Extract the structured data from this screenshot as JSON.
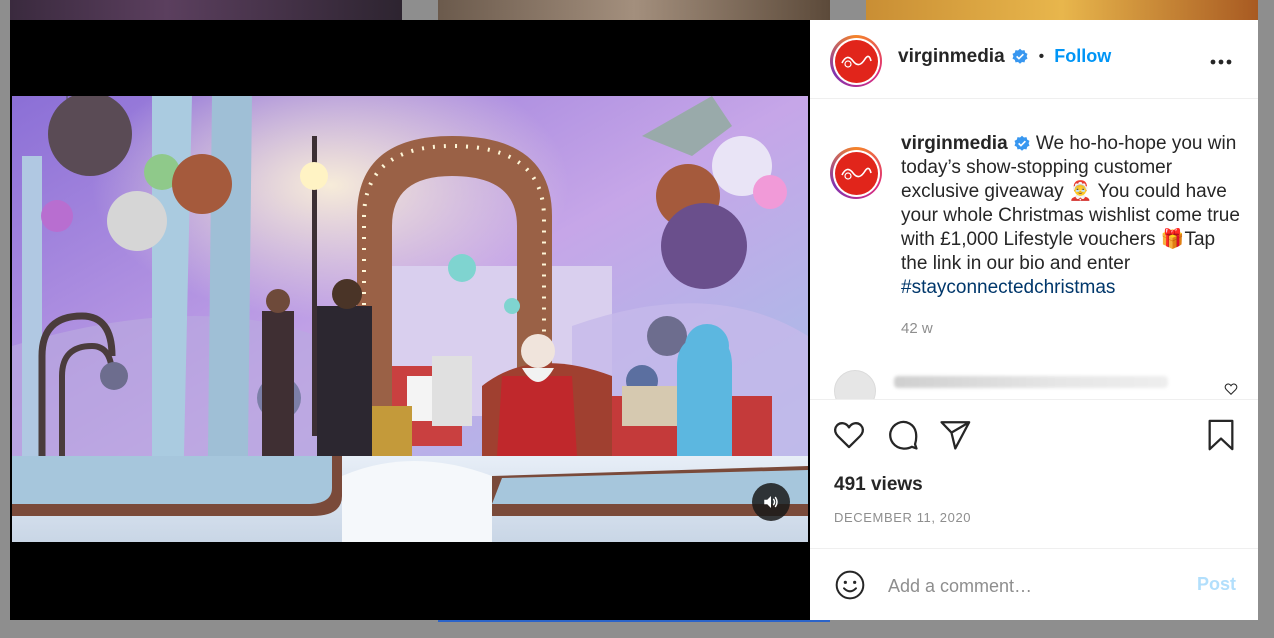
{
  "post": {
    "username": "virginmedia",
    "verified": true,
    "separator": "•",
    "follow_label": "Follow",
    "more_icon": "more-horizontal-icon",
    "caption": {
      "part1": " We ho-ho-hope you win today’s show-stopping customer exclusive giveaway ",
      "emoji1": "🤶",
      "part2": " You could have your whole Christmas wishlist come true with £1,000 Lifestyle vouchers ",
      "emoji2": "🎁",
      "part3": "Tap the link in our bio and enter ",
      "hashtag": "#stayconnectedchristmas"
    },
    "time_ago": "42 w",
    "views": "491 views",
    "date": "DECEMBER 11, 2020"
  },
  "comment_input": {
    "placeholder": "Add a comment…",
    "post_label": "Post"
  },
  "icons": {
    "like": "heart-icon",
    "comment": "comment-icon",
    "share": "send-icon",
    "save": "bookmark-icon",
    "emoji": "emoji-icon",
    "mute": "speaker-icon"
  },
  "colors": {
    "follow": "#0095f6",
    "hashtag": "#00376b",
    "brand_red": "#e1251b",
    "post_disabled": "#b2dffc"
  }
}
